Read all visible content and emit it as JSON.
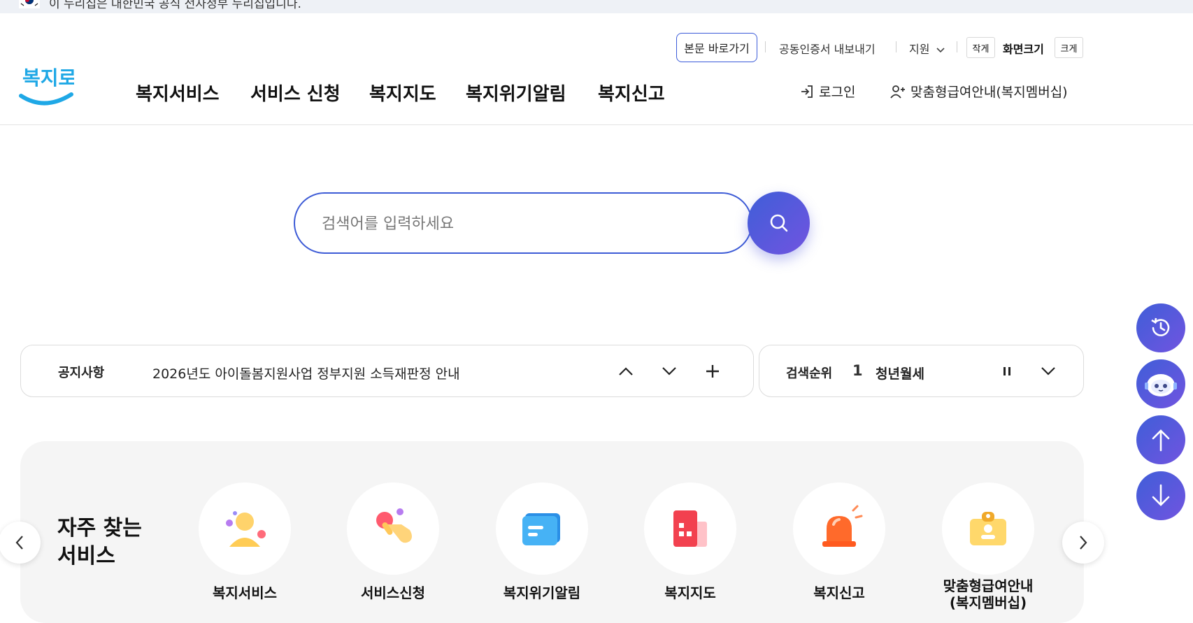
{
  "gov_banner": {
    "text": "이 누리집은 대한민국 공식 전자정부 누리집입니다."
  },
  "header": {
    "skip_label": "본문 바로가기",
    "cert_label": "공동인증서 내보내기",
    "support_label": "지원",
    "size_small": "작게",
    "size_label": "화면크기",
    "size_large": "크게",
    "logo_text": "복지로",
    "nav": [
      "복지서비스",
      "서비스 신청",
      "복지지도",
      "복지위기알림",
      "복지신고"
    ],
    "login_label": "로그인",
    "member_label": "맞춤형급여안내(복지멤버십)"
  },
  "search": {
    "placeholder": "검색어를 입력하세요"
  },
  "notice": {
    "label": "공지사항",
    "text": "2026년도 아이돌봄지원사업 정부지원 소득재판정 안내"
  },
  "rank": {
    "label": "검색순위",
    "number": "1",
    "keyword": "청년월세"
  },
  "frequent": {
    "title_line1": "자주 찾는",
    "title_line2": "서비스",
    "items": [
      {
        "label": "복지서비스",
        "icon": "person-icon"
      },
      {
        "label": "서비스신청",
        "icon": "hand-tap-icon"
      },
      {
        "label": "복지위기알림",
        "icon": "message-icon"
      },
      {
        "label": "복지지도",
        "icon": "map-building-icon"
      },
      {
        "label": "복지신고",
        "icon": "siren-icon"
      },
      {
        "label": "맞춤형급여안내\n(복지멤버십)",
        "icon": "id-badge-icon"
      }
    ]
  },
  "floating": [
    "history-icon",
    "chatbot-icon",
    "arrow-up-icon",
    "arrow-down-icon"
  ],
  "colors": {
    "accent": "#3d5bd6",
    "accent2": "#7154e0",
    "logo_blue": "#1fa8e6"
  }
}
